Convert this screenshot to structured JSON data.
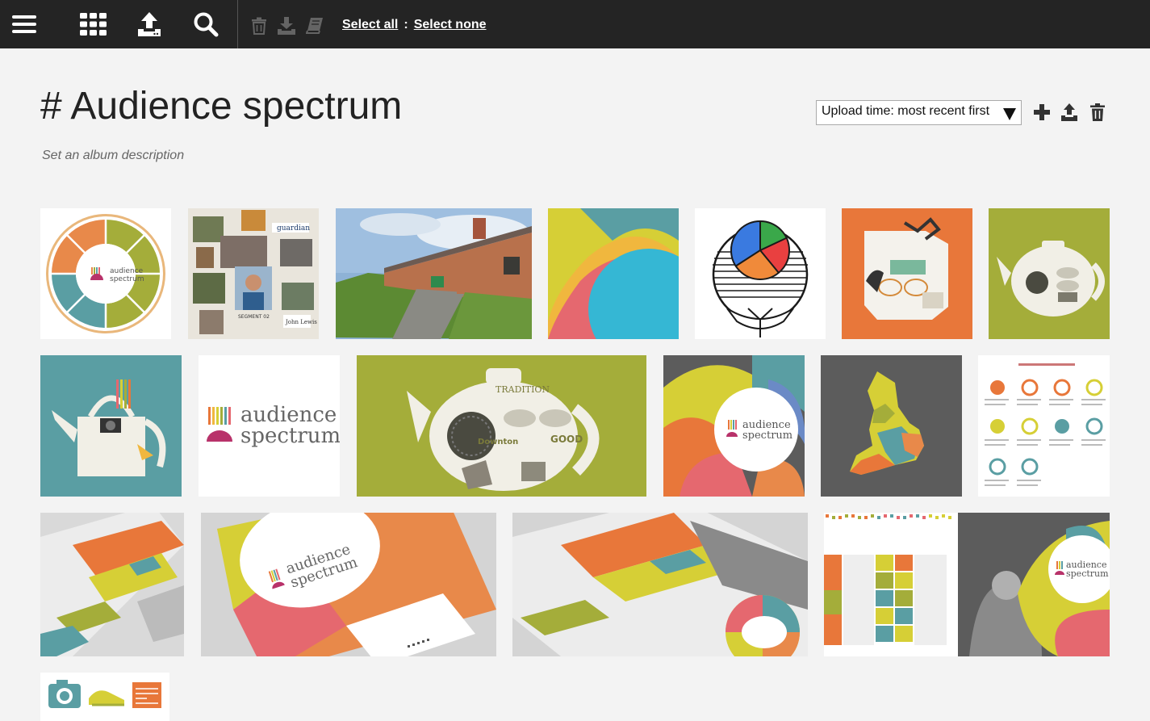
{
  "toolbar": {
    "select_all": "Select all",
    "separator": ":",
    "select_none": "Select none",
    "icons": [
      "menu-icon",
      "grid-icon",
      "upload-icon",
      "search-icon",
      "trash-icon",
      "download-icon",
      "book-icon"
    ]
  },
  "album": {
    "title": "# Audience spectrum",
    "description": "Set an album description"
  },
  "sort": {
    "selected": "Upload time: most recent first"
  },
  "actions": {
    "icons": [
      "plus-icon",
      "upload-icon",
      "trash-icon"
    ]
  },
  "thumbs": {
    "audience": "audience",
    "spectrum": "spectrum",
    "guardian": "guardian",
    "segment": "SEGMENT 02",
    "john_lewis": "John Lewis",
    "tradition": "TRADITION",
    "downton": "Downton",
    "good": "GOOD"
  },
  "colors": {
    "topbar": "#242424",
    "background": "#f3f3f3",
    "teal": "#5a9ea3",
    "olive": "#a4ad3a",
    "orange": "#e8773a",
    "pink": "#e5686f",
    "yellow": "#d6cf36",
    "cyan": "#35b7d4",
    "grey": "#5c5c5c"
  }
}
